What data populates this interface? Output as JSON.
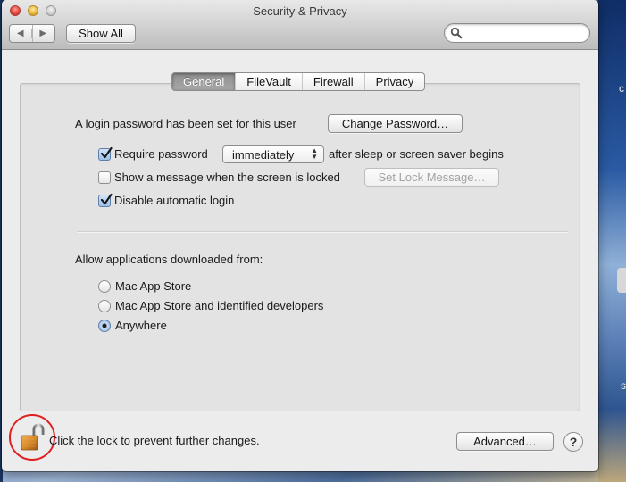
{
  "window": {
    "title": "Security & Privacy",
    "traffic_lights": [
      "close",
      "minimize",
      "zoom"
    ]
  },
  "toolbar": {
    "back_icon": "triangle-left-icon",
    "forward_icon": "triangle-right-icon",
    "back_glyph": "◀",
    "forward_glyph": "▶",
    "show_all_label": "Show All",
    "search": {
      "icon": "magnifier-icon",
      "value": "",
      "placeholder": ""
    }
  },
  "tabs": [
    {
      "label": "General",
      "active": true
    },
    {
      "label": "FileVault",
      "active": false
    },
    {
      "label": "Firewall",
      "active": false
    },
    {
      "label": "Privacy",
      "active": false
    }
  ],
  "general": {
    "login_password_text": "A login password has been set for this user",
    "change_password_label": "Change Password…",
    "require_password": {
      "checked": true,
      "label": "Require password",
      "popup_value": "immediately",
      "popup_arrows": "▲\n▼",
      "suffix": "after sleep or screen saver begins"
    },
    "show_message": {
      "checked": false,
      "label": "Show a message when the screen is locked",
      "button_label": "Set Lock Message…",
      "button_enabled": false
    },
    "disable_auto_login": {
      "checked": true,
      "label": "Disable automatic login"
    },
    "allow_apps": {
      "heading": "Allow applications downloaded from:",
      "options": [
        {
          "label": "Mac App Store",
          "selected": false
        },
        {
          "label": "Mac App Store and identified developers",
          "selected": false
        },
        {
          "label": "Anywhere",
          "selected": true
        }
      ]
    }
  },
  "footer": {
    "lock_state": "unlocked",
    "lock_text": "Click the lock to prevent further changes.",
    "advanced_label": "Advanced…",
    "help_label": "?"
  },
  "annotation": {
    "type": "circle",
    "color": "#e02020",
    "target": "lock"
  },
  "colors": {
    "window_bg": "#ececec",
    "panel_bg": "#e3e3e3",
    "active_tab": "#9a9a9a",
    "checkbox_checked": "#9cc1e9"
  }
}
